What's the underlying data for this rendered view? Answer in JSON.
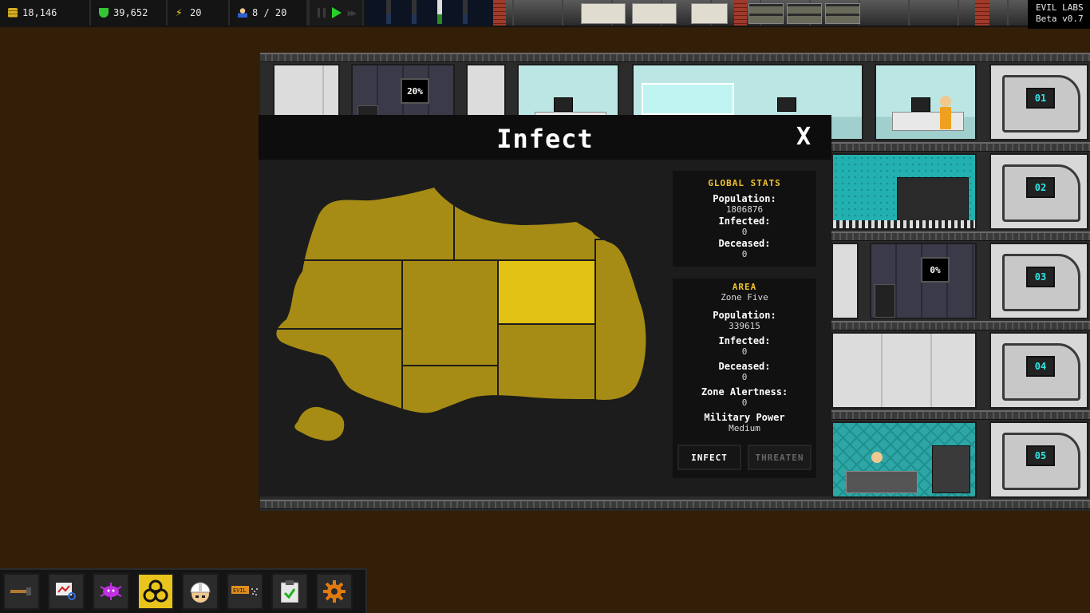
{
  "resources": {
    "money": "18,146",
    "research": "39,652",
    "power": "20",
    "staff": "8 / 20"
  },
  "speed_controls": [
    "pause",
    "play",
    "fast-forward"
  ],
  "version": {
    "name": "EVIL LABS",
    "build": "Beta v0.7"
  },
  "rooms": {
    "progress_1": "20%",
    "progress_2": "0%"
  },
  "vaults": [
    "01",
    "02",
    "03",
    "04",
    "05"
  ],
  "modal": {
    "title": "Infect",
    "close_label": "X",
    "selected_zone": "Zone Five",
    "map_colors": {
      "zone": "#a68c14",
      "selected_zone": "#e2c212",
      "border": "#1c1c1c"
    },
    "global_stats": {
      "title": "GLOBAL STATS",
      "population_label": "Population:",
      "population": "1806876",
      "infected_label": "Infected:",
      "infected": "0",
      "deceased_label": "Deceased:",
      "deceased": "0"
    },
    "area": {
      "title": "AREA",
      "name": "Zone Five",
      "population_label": "Population:",
      "population": "339615",
      "infected_label": "Infected:",
      "infected": "0",
      "deceased_label": "Deceased:",
      "deceased": "0",
      "alertness_label": "Zone Alertness:",
      "alertness": "0",
      "military_label": "Military Power",
      "military": "Medium"
    },
    "buttons": {
      "infect": "INFECT",
      "threaten": "THREATEN"
    }
  },
  "toolbar": {
    "active_tool": "biohazard",
    "tools": [
      "build-hammer",
      "stats-monitor",
      "virus",
      "biohazard",
      "worker",
      "evil-sprayer",
      "clipboard",
      "settings-gear"
    ]
  }
}
